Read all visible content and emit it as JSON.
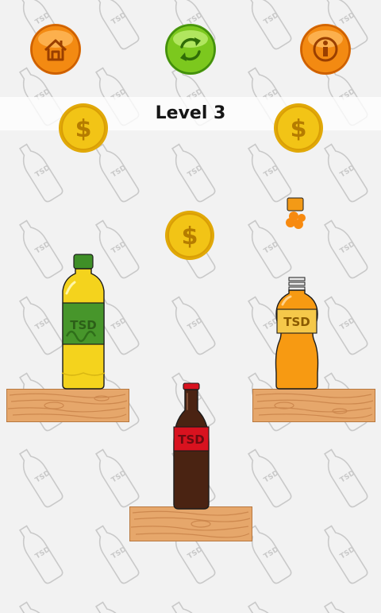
{
  "header": {
    "level_label": "Level 3"
  },
  "buttons": {
    "home_icon": "home-icon",
    "restart_icon": "restart-icon",
    "info_icon": "info-icon"
  },
  "bottles": {
    "green": {
      "label": "TSD"
    },
    "red": {
      "label": "TSD"
    },
    "orange": {
      "label": "TSD"
    }
  },
  "background": {
    "watermark_label": "TSD"
  },
  "colors": {
    "home_button": "#f38a12",
    "restart_button": "#7cc81e",
    "info_button": "#f38a12",
    "coin": "#f2c416",
    "shelf": "#e6a76b",
    "green_bottle_cap": "#3f8f27",
    "yellow_liquid": "#f4d31d",
    "red_label": "#d8121f",
    "cola_liquid": "#4a2312",
    "orange_liquid": "#f79a12"
  }
}
